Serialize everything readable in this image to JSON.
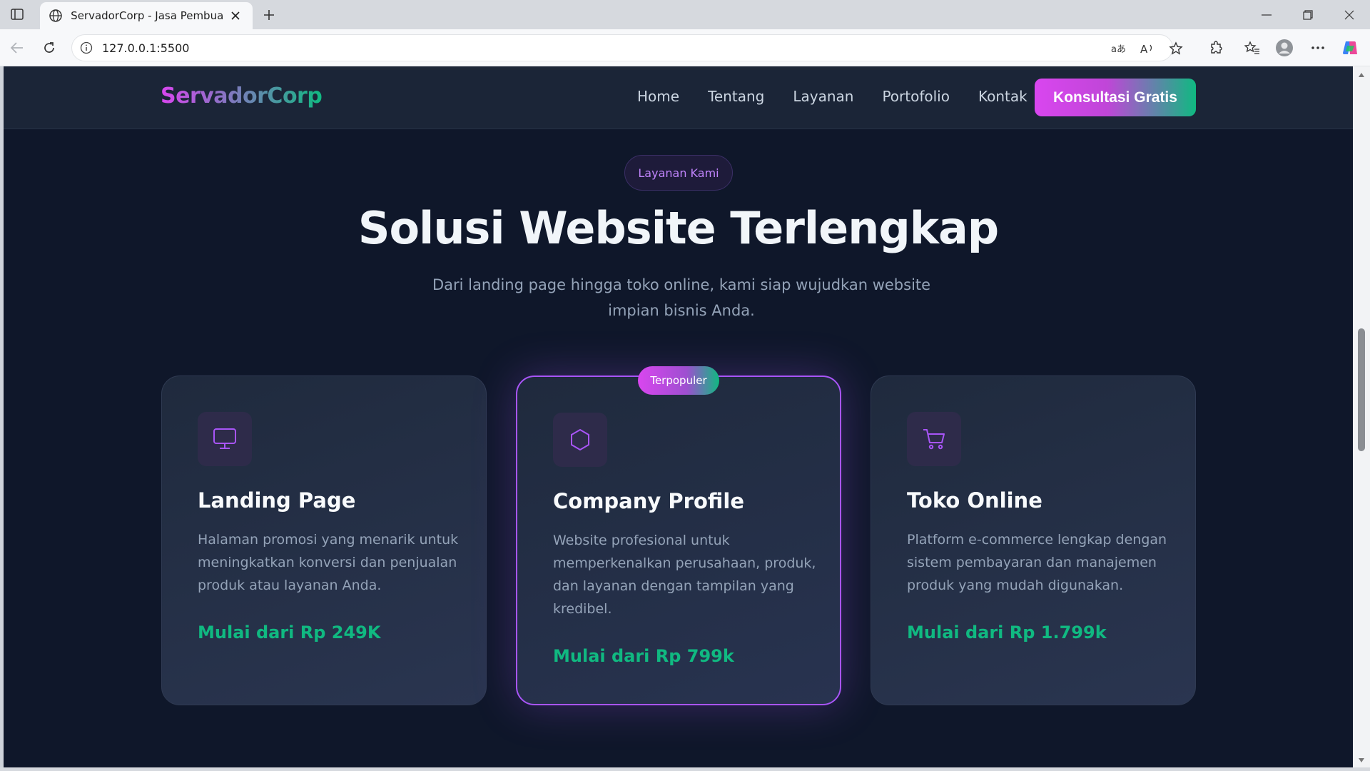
{
  "browser": {
    "tab_title": "ServadorCorp - Jasa Pembuatan W",
    "url": "127.0.0.1:5500"
  },
  "site": {
    "brand": "ServadorCorp",
    "nav": [
      "Home",
      "Tentang",
      "Layanan",
      "Portofolio",
      "Kontak"
    ],
    "cta_label": "Konsultasi Gratis"
  },
  "section": {
    "badge": "Layanan Kami",
    "title": "Solusi Website Terlengkap",
    "subtitle": "Dari landing page hingga toko online, kami siap wujudkan website impian bisnis Anda."
  },
  "cards": [
    {
      "icon": "monitor-icon",
      "title": "Landing Page",
      "description": "Halaman promosi yang menarik untuk meningkatkan konversi dan penjualan produk atau layanan Anda.",
      "price": "Mulai dari Rp 249K"
    },
    {
      "icon": "hexagon-icon",
      "title": "Company Profile",
      "description": "Website profesional untuk memperkenalkan perusahaan, produk, dan layanan dengan tampilan yang kredibel.",
      "price": "Mulai dari Rp 799k",
      "badge": "Terpopuler"
    },
    {
      "icon": "cart-icon",
      "title": "Toko Online",
      "description": "Platform e-commerce lengkap dengan sistem pembayaran dan manajemen produk yang mudah digunakan.",
      "price": "Mulai dari Rp 1.799k"
    }
  ],
  "colors": {
    "page_bg": "#0f172a",
    "accent_purple": "#a855f7",
    "accent_pink": "#d946ef",
    "accent_green": "#10b981"
  }
}
